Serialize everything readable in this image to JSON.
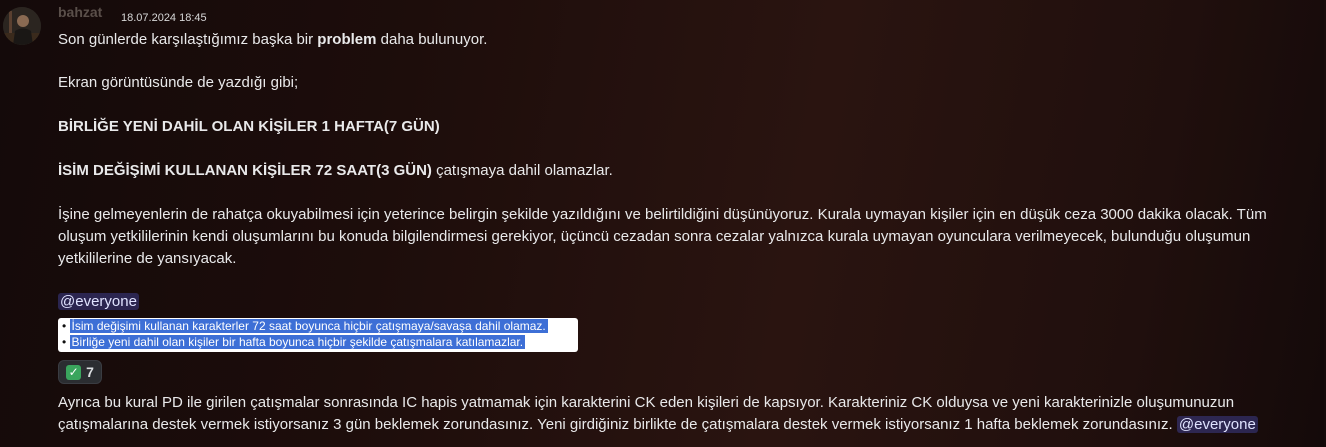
{
  "message": {
    "author": "bahzat",
    "timestamp": "18.07.2024 18:45",
    "lines": {
      "l1_pre": "Son günlerde karşılaştığımız başka bir ",
      "l1_bold": "problem",
      "l1_post": " daha bulunuyor.",
      "l2": "Ekran görüntüsünde de yazdığı gibi;",
      "l3_bold": "BİRLİĞE YENİ DAHİL OLAN KİŞİLER 1 HAFTA(7 GÜN)",
      "l4_bold": "İSİM DEĞİŞİMİ KULLANAN KİŞİLER 72 SAAT(3 GÜN)",
      "l4_post": " çatışmaya dahil olamazlar.",
      "p1": "İşine gelmeyenlerin de rahatça okuyabilmesi için yeterince belirgin şekilde yazıldığını ve belirtildiğini düşünüyoruz. Kurala uymayan kişiler için en düşük ceza 3000 dakika olacak. Tüm",
      "p2": "oluşum yetkililerinin kendi oluşumlarını bu konuda bilgilendirmesi gerekiyor, üçüncü cezadan sonra cezalar yalnızca kurala uymayan oyunculara verilmeyecek, bulunduğu oluşumun",
      "p3": "yetkililerine de yansıyacak.",
      "mention": "@everyone",
      "final1": "Ayrıca bu kural PD ile girilen çatışmalar sonrasında IC hapis yatmamak için karakterini CK eden kişileri de kapsıyor. Karakteriniz CK olduysa ve yeni karakterinizle oluşumunuzun",
      "final2": "çatışmalarına destek vermek istiyorsanız 3 gün beklemek zorundasınız. Yeni girdiğiniz birlikte de çatışmalara destek vermek istiyorsanız 1 hafta beklemek zorundasınız. ",
      "final_mention": "@everyone"
    },
    "image_bullets": [
      "İsim değişimi kullanan karakterler 72 saat boyunca hiçbir çatışmaya/savaşa dahil olamaz.",
      "Birliğe yeni dahil olan kişiler bir hafta boyunca hiçbir şekilde çatışmalara katılamazlar."
    ],
    "reaction": {
      "emoji": "white-check-mark",
      "count": "7"
    }
  },
  "colors": {
    "mention_bg": "#5865f2",
    "highlight": "#3d6fd6",
    "reaction_check": "#3aa55d"
  }
}
